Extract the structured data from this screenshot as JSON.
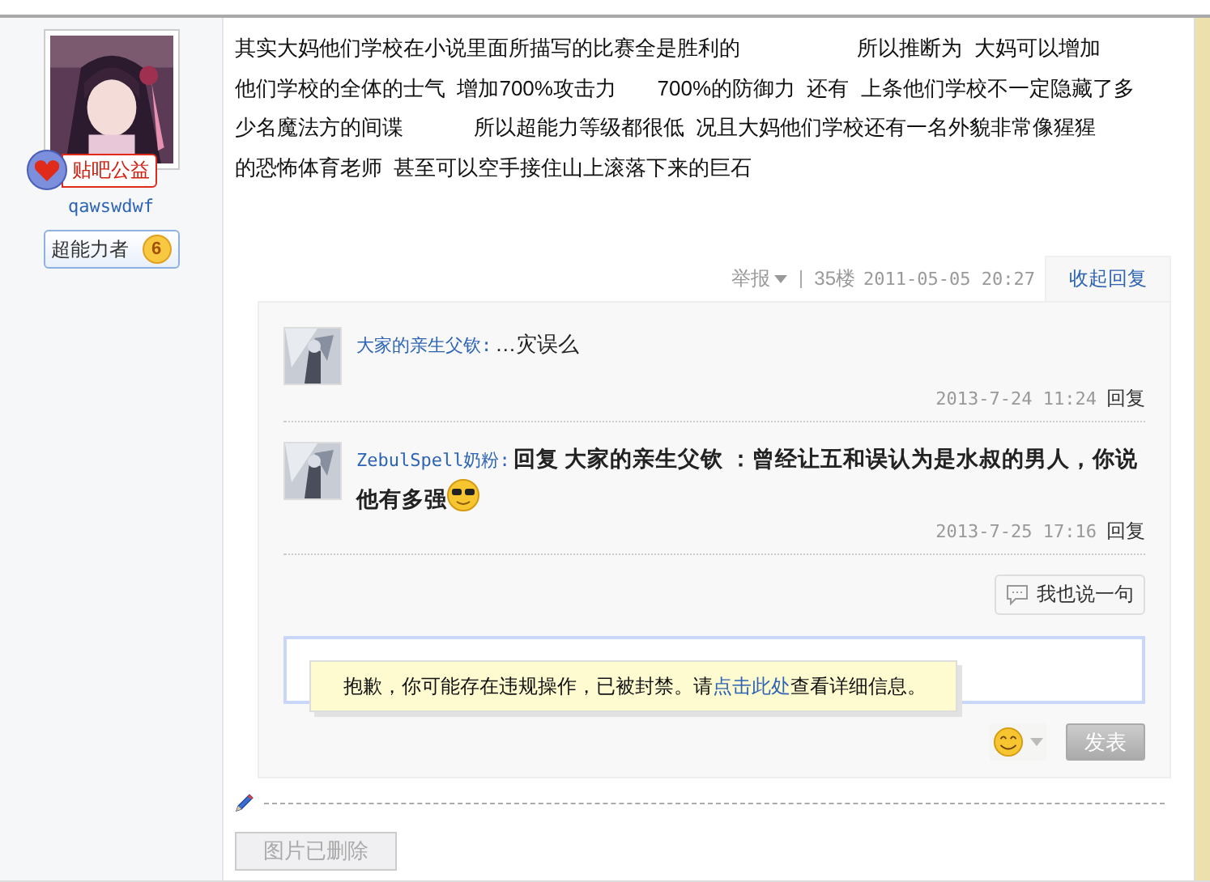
{
  "author": {
    "badge": "贴吧公益",
    "username": "qawswdwf",
    "rank_title": "超能力者",
    "rank": "6"
  },
  "post": {
    "lines": [
      "其实大妈他们学校在小说里面所描写的比赛全是胜利的                    所以推断为  大妈可以增加",
      "他们学校的全体的士气  增加700%攻击力       700%的防御力  还有  上条他们学校不一定隐藏了多",
      "少名魔法方的间谍            所以超能力等级都很低  况且大妈他们学校还有一名外貌非常像猩猩",
      "的恐怖体育老师  甚至可以空手接住山上滚落下来的巨石"
    ],
    "report": "举报",
    "floor": "35楼",
    "time": "2011-05-05 20:27",
    "toggle_replies": "收起回复"
  },
  "replies": [
    {
      "name": "大家的亲生父钦:",
      "text": "…灾误么",
      "bold": false,
      "emoji": false,
      "time": "2013-7-24 11:24",
      "reply": "回复"
    },
    {
      "name": "ZebulSpell奶粉:",
      "text": "回复  大家的亲生父钦 ：曾经让五和误认为是水叔的男人，你说他有多强",
      "bold": true,
      "emoji": true,
      "time": "2013-7-25 17:16",
      "reply": "回复"
    }
  ],
  "say_button": "我也说一句",
  "notice": {
    "before": "抱歉，你可能存在违规操作，已被封禁。请",
    "link": "点击此处",
    "after": "查看详细信息。"
  },
  "submit": "发表",
  "image_deleted": "图片已删除"
}
